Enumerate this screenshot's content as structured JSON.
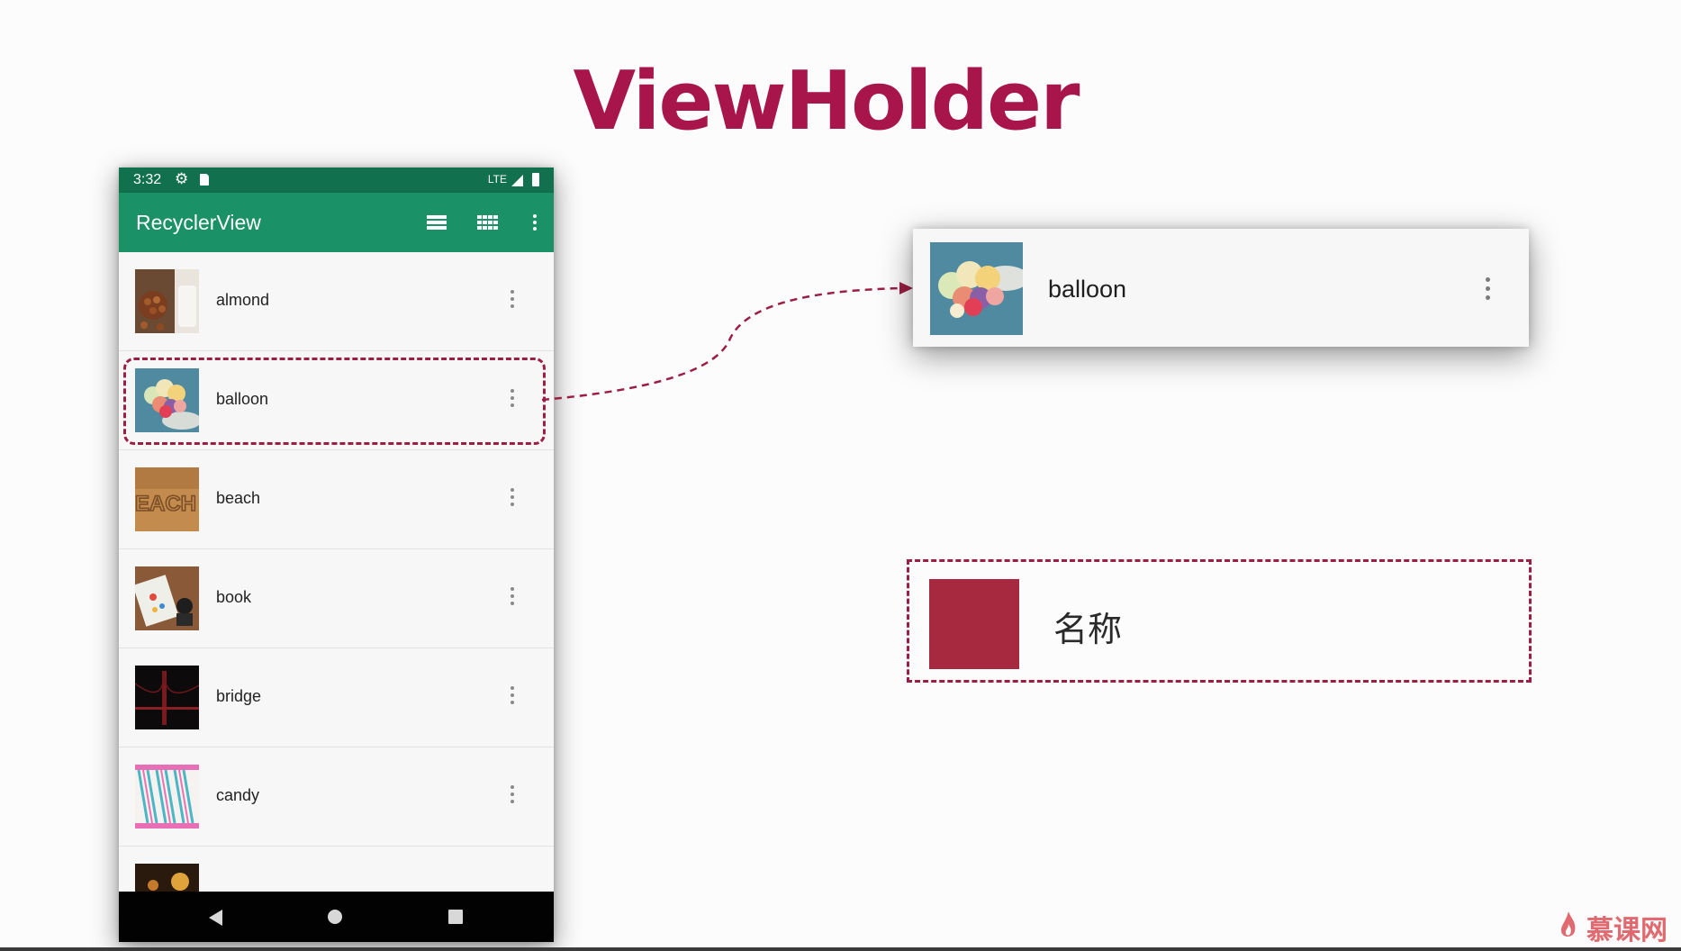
{
  "slide": {
    "title": "ViewHolder"
  },
  "status_bar": {
    "time": "3:32",
    "network": "LTE"
  },
  "app_bar": {
    "title": "RecyclerView"
  },
  "list": {
    "items": [
      {
        "label": "almond"
      },
      {
        "label": "balloon"
      },
      {
        "label": "beach"
      },
      {
        "label": "book"
      },
      {
        "label": "bridge"
      },
      {
        "label": "candy"
      }
    ]
  },
  "detail": {
    "label": "balloon"
  },
  "wireframe": {
    "name_label": "名称"
  },
  "watermark": {
    "text": "慕课网"
  },
  "colors": {
    "title": "#a8154a",
    "app_bar": "#1a9166",
    "status_bar": "#11704d",
    "highlight": "#9c1e44",
    "placeholder_image": "#a6293f"
  }
}
